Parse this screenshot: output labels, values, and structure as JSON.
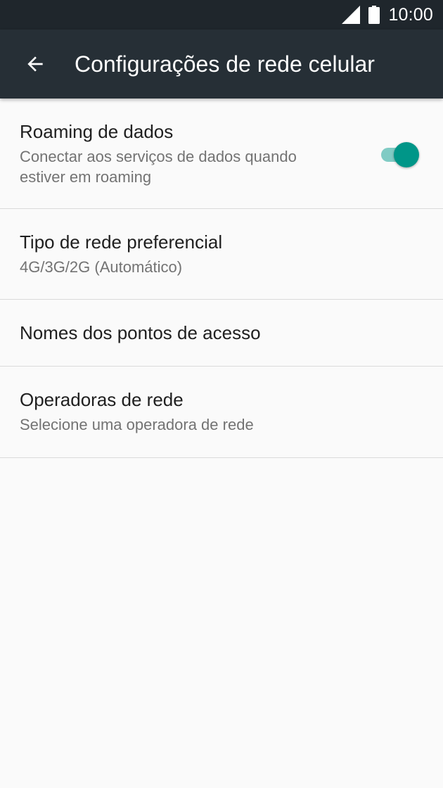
{
  "status_bar": {
    "time": "10:00",
    "icons": [
      "signal-icon",
      "battery-icon"
    ]
  },
  "toolbar": {
    "title": "Configurações de rede celular",
    "back_icon": "arrow-back-icon"
  },
  "settings": [
    {
      "title": "Roaming de dados",
      "subtitle": "Conectar aos serviços de dados quando estiver em roaming",
      "toggle": true
    },
    {
      "title": "Tipo de rede preferencial",
      "subtitle": "4G/3G/2G (Automático)"
    },
    {
      "title": "Nomes dos pontos de acesso"
    },
    {
      "title": "Operadoras de rede",
      "subtitle": "Selecione uma operadora de rede"
    }
  ],
  "colors": {
    "status_bar": "#1f262c",
    "toolbar": "#262f36",
    "background": "#fafafa",
    "accent": "#009688",
    "accent_track": "#80cbc4"
  }
}
